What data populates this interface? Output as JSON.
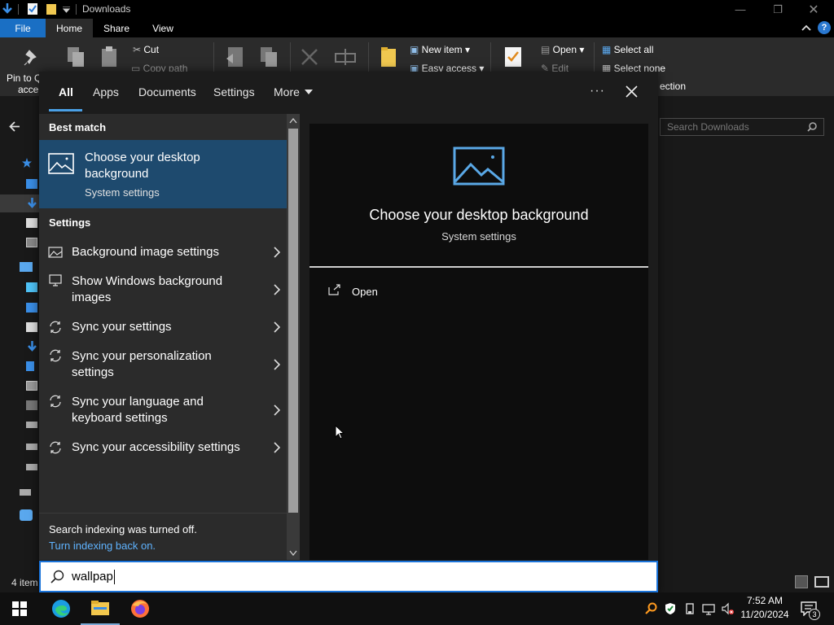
{
  "window": {
    "title": "Downloads",
    "tabs": [
      "File",
      "Home",
      "Share",
      "View"
    ],
    "ribbon": {
      "pin": "Pin to Q",
      "pin_line2": "acce",
      "cut": "Cut",
      "copy_path": "Copy path",
      "new_item": "New item",
      "easy_access": "Easy access",
      "open": "Open",
      "edit": "Edit",
      "select_all": "Select all",
      "select_none": "Select none",
      "invert_selection": "ection"
    },
    "search_placeholder": "Search Downloads",
    "status": "4 item"
  },
  "flyout": {
    "tabs": {
      "all": "All",
      "apps": "Apps",
      "documents": "Documents",
      "settings": "Settings",
      "more": "More"
    },
    "best_match_header": "Best match",
    "best_match": {
      "title": "Choose your desktop background",
      "subtitle": "System settings"
    },
    "settings_header": "Settings",
    "results": [
      {
        "label": "Background image settings",
        "icon": "image-icon"
      },
      {
        "label": "Show Windows background images",
        "icon": "monitor-icon"
      },
      {
        "label": "Sync your settings",
        "icon": "sync-icon"
      },
      {
        "label": "Sync your personalization settings",
        "icon": "sync-icon"
      },
      {
        "label": "Sync your language and keyboard settings",
        "icon": "sync-icon"
      },
      {
        "label": "Sync your accessibility settings",
        "icon": "sync-icon"
      }
    ],
    "indexing": {
      "message": "Search indexing was turned off.",
      "link": "Turn indexing back on."
    },
    "preview": {
      "title": "Choose your desktop background",
      "subtitle": "System settings",
      "open_label": "Open"
    },
    "query": "wallpap"
  },
  "taskbar": {
    "apps": [
      "windows-start-icon",
      "edge-icon",
      "file-explorer-icon",
      "firefox-icon"
    ],
    "time": "7:52 AM",
    "date": "11/20/2024",
    "notification_count": "3"
  },
  "colors": {
    "accent": "#1e4a6e",
    "link": "#5fb3ff",
    "selection_border": "#1a73d9",
    "file_tab": "#1a6fc4"
  }
}
